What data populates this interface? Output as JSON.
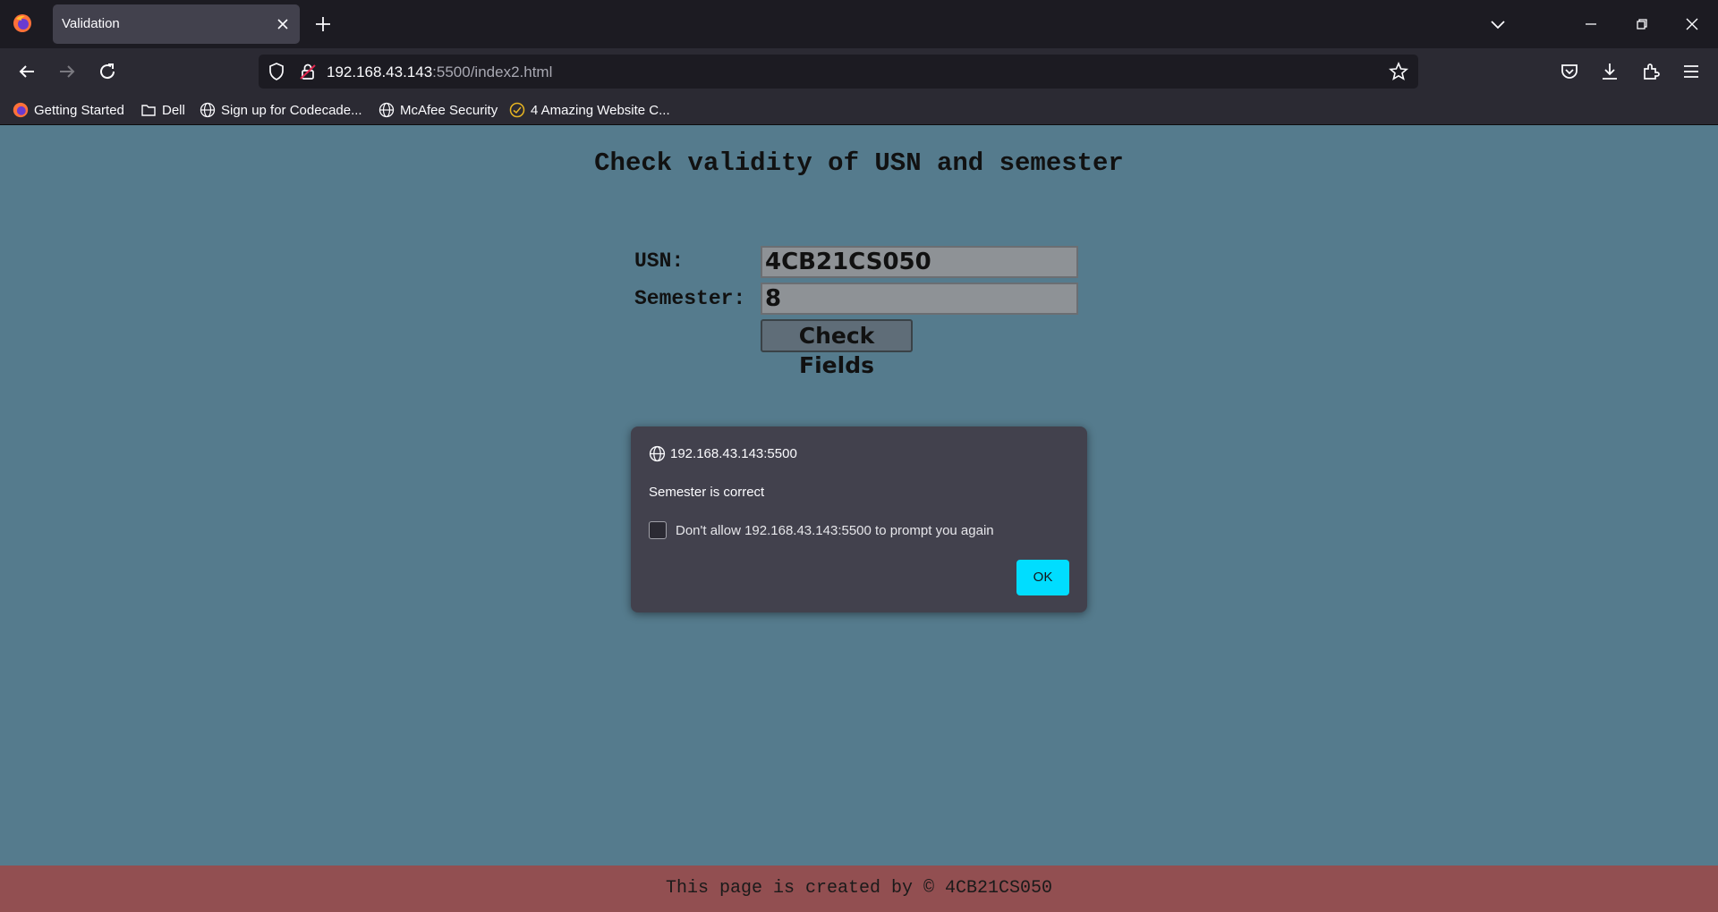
{
  "browser": {
    "tab_title": "Validation",
    "url_host": "192.168.43.143",
    "url_rest": ":5500/index2.html"
  },
  "bookmarks": [
    {
      "label": "Getting Started",
      "icon": "firefox-icon"
    },
    {
      "label": "Dell",
      "icon": "folder-icon"
    },
    {
      "label": "Sign up for Codecade...",
      "icon": "globe-icon"
    },
    {
      "label": "McAfee Security",
      "icon": "globe-icon"
    },
    {
      "label": "4 Amazing Website C...",
      "icon": "check-circle-icon"
    }
  ],
  "page": {
    "title": "Check validity of USN and semester",
    "usn_label": "USN:",
    "usn_value": "4CB21CS050",
    "semester_label": "Semester:",
    "semester_value": "8",
    "check_button": "Check Fields"
  },
  "dialog": {
    "origin": "192.168.43.143:5500",
    "message": "Semester is correct",
    "checkbox_label": "Don't allow 192.168.43.143:5500 to prompt you again",
    "ok_label": "OK"
  },
  "footer": {
    "text": "This page is created by © 4CB21CS050"
  },
  "colors": {
    "page_bg": "#557b8d",
    "footer_bg": "#924f51",
    "dialog_bg": "#42414d",
    "ok_button": "#00ddff"
  }
}
